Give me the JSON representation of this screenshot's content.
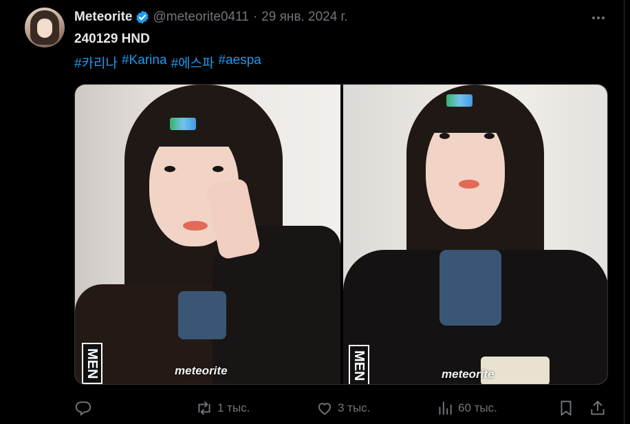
{
  "tweet": {
    "author_name": "Meteorite",
    "handle": "@meteorite0411",
    "separator": "·",
    "date": "29 янв. 2024 г.",
    "text": "240129 HND",
    "hashtags": [
      "#카리나",
      "#Karina",
      "#에스파",
      "#aespa"
    ]
  },
  "media": {
    "watermark_left": "meteorite",
    "watermark_right": "meteorite",
    "badge_text": "MEN"
  },
  "actions": {
    "reply_count": "",
    "retweet_count": "1 тыс.",
    "like_count": "3 тыс.",
    "views_count": "60 тыс."
  },
  "colors": {
    "background": "#000000",
    "text_primary": "#e7e9ea",
    "text_secondary": "#71767b",
    "link": "#1d9bf0",
    "verified": "#1d9bf0"
  },
  "icons": [
    "verified-badge-icon",
    "more-options-icon",
    "reply-icon",
    "retweet-icon",
    "like-icon",
    "views-icon",
    "bookmark-icon",
    "share-icon"
  ]
}
